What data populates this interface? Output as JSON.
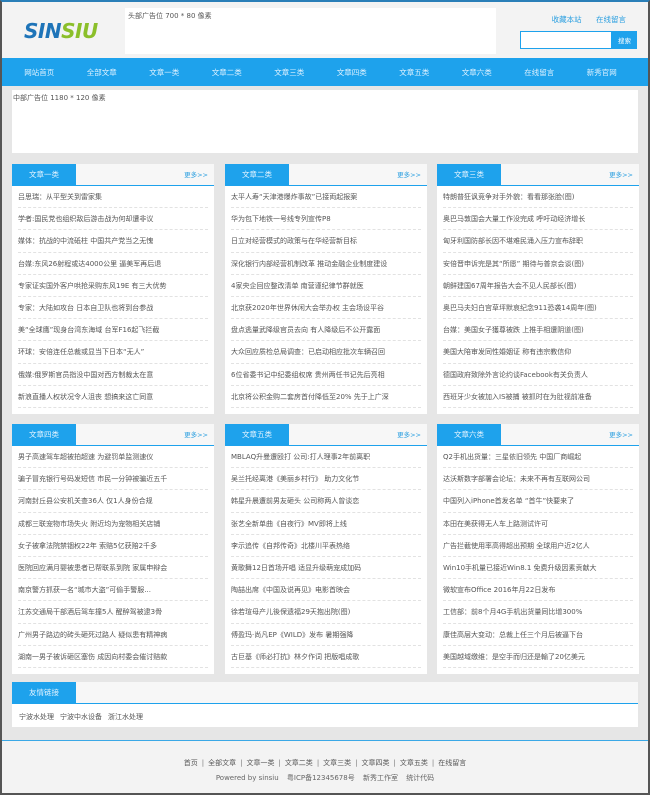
{
  "logo": {
    "part1": "SIN",
    "part2": "SIU"
  },
  "header": {
    "top_ad_text": "头部广告位 700 * 80 像素",
    "links": [
      "收藏本站",
      "在线留言"
    ],
    "search_placeholder": "",
    "search_button": "搜索"
  },
  "nav": [
    "网站首页",
    "全部文章",
    "文章一类",
    "文章二类",
    "文章三类",
    "文章四类",
    "文章五类",
    "文章六类",
    "在线留言",
    "新秀官网"
  ],
  "middle_ad_text": "中部广告位 1180 * 120 像素",
  "more_label": "更多>>",
  "panels": [
    {
      "title": "文章一类",
      "items": [
        "吕思瑞：从平型关到雷家集",
        "学者:国民党也组织敌后游击战为何却遭非议",
        "媒体：抗战的中流砥柱 中国共产党当之无愧",
        "台媒:东风26射程或达4000公里 逼美军再后退",
        "专家证实国外客户哄抢采购东风19E 有三大优势",
        "专家：大陆如攻台 日本自卫队也将到台参战",
        "美“全球鹰”现身台湾东海域 台军F16起飞拦截",
        "环球：安倍连任总裁或显当下日本“无人”",
        "俄媒:俄罗斯官员指没中国对西方制裁太在意",
        "新浪直播人权状况令人沮丧 想搞来这亡同意"
      ]
    },
    {
      "title": "文章二类",
      "items": [
        "太平人寿“天津港爆炸事故”已接両起报案",
        "华为包下地铁一号线专列宣传P8",
        "日立对经营模式的政策与在华经营新目标",
        "深化银行内部经营机制改革 推动金融企业制度建设",
        "4家央企回应整改清单 南营谨纪律节群就医",
        "北京获2020年世界休闲大会举办权 主会场设平谷",
        "盘点逃量武降级官员去向 有人降级后不公开露面",
        "大众回应质检总局调查：已启动相应批次车辆召回",
        "6位省委书记中纪委组权席 贵州两任书记先后亮相",
        "北京将公积金购二套房首付降低至20% 先于上广深"
      ]
    },
    {
      "title": "文章三类",
      "items": [
        "特朗普狂讽竞争对手外貌：看看那张脸(图)",
        "奥巴马敦国会大量工作没完成 呼吁动经济增长",
        "匈牙利国防部长因不堪难民涌入压力宣布辞职",
        "安倍晋申诉完是其“所愿” 期待与普京会谈(图)",
        "朝鲜建国67周年报告大会不见人民部长(图)",
        "奥巴马夫妇白宫草坪默哀纪念911恐袭14周年(图)",
        "台媒：美国女子獲尊被跌 上推手相遭阴道(图)",
        "美国大陪审发同性婚姻证 称有违宗教信仰",
        "德国政府致除外言论约谈Facebook有关负责人",
        "西班牙少女被加入IS被捕 被抓时在为肚视前准备"
      ]
    },
    {
      "title": "文章四类",
      "items": [
        "男子高速驾车超被拍超速 为避罚单监测速仪",
        "骗子冒充银行号码发短信 市民一分钟被骗近五千",
        "河南封丘县公安机关查36人 仅1人身份合规",
        "成都三联宠物市场失火 附近均为宠物相关店铺",
        "女子被拿法院禁锢权22年 索赔5亿获赔2千多",
        "医院回应满月婴被患者已帮联系到院 家属申辩会",
        "南京警方抓获一名“城市大盗”可偷手警服...",
        "江苏交通局干部酒后驾车撞5人 醒醉驾被逮3骨",
        "广州男子路边的砖头砸死过路人 疑似患有精神病",
        "湖南一男子被诉砸区塞伤 成因向村委会催讨赔款"
      ]
    },
    {
      "title": "文章五类",
      "items": [
        "MBLAQ升曼遭殴打 公司:打人理事2年前离职",
        "吴兰托经离港《美丽乡村行》 助力文化节",
        "韩星升晨遭前男友砸头 公司称两人曾谈恋",
        "张艺全新单曲《自夜行》MV即将上线",
        "李示追传《自邦传奇》北楼川平表热络",
        "黄歌舞12日首场开唱 适显升级萌宠成加码",
        "陶喆出席《中国及说再见》电影首映会",
        "徐若瑄母产儿後保遗福29天抱出院(图)",
        "傅盈玛·尚凡EP《WILD》发布 暑期强降",
        "古巨基《师必打抗》林夕作词 把版唱成歌"
      ]
    },
    {
      "title": "文章六类",
      "items": [
        "Q2手机出货量：三星依旧领先 中国厂商崛起",
        "达沃斯数字部署会论坛：未来不再有互联网公司",
        "中国列入iPhone首发名单 “首牛”快要来了",
        "本田在美获得无人车上路测试许可",
        "广告拦截使用率高得超出预期 全球用户近2亿人",
        "Win10手机量已接近Win8.1 免费升级因素贡献大",
        "微软宣布Office 2016年月22日发布",
        "工信部：前8个月4G手机出货量同比增300%",
        "康佳高层大变动：总裁上任三个月后被逼下台",
        "美国越域缴维：是空手而归还是輸了20亿美元"
      ]
    }
  ],
  "friends": {
    "title": "友情链接",
    "links": [
      "宁波水处理",
      "宁波中水设备",
      "浙江水处理"
    ]
  },
  "footer": {
    "nav": [
      "首页",
      "全部文章",
      "文章一类",
      "文章二类",
      "文章三类",
      "文章四类",
      "文章五类",
      "在线留言"
    ],
    "powered": "Powered by sinsiu",
    "icp": "粤ICP备12345678号",
    "studio": "新秀工作室",
    "stats": "统计代码"
  },
  "colors": {
    "accent": "#1ea2ec",
    "logo_blue": "#1e74b8",
    "logo_green": "#8bbf2a"
  }
}
